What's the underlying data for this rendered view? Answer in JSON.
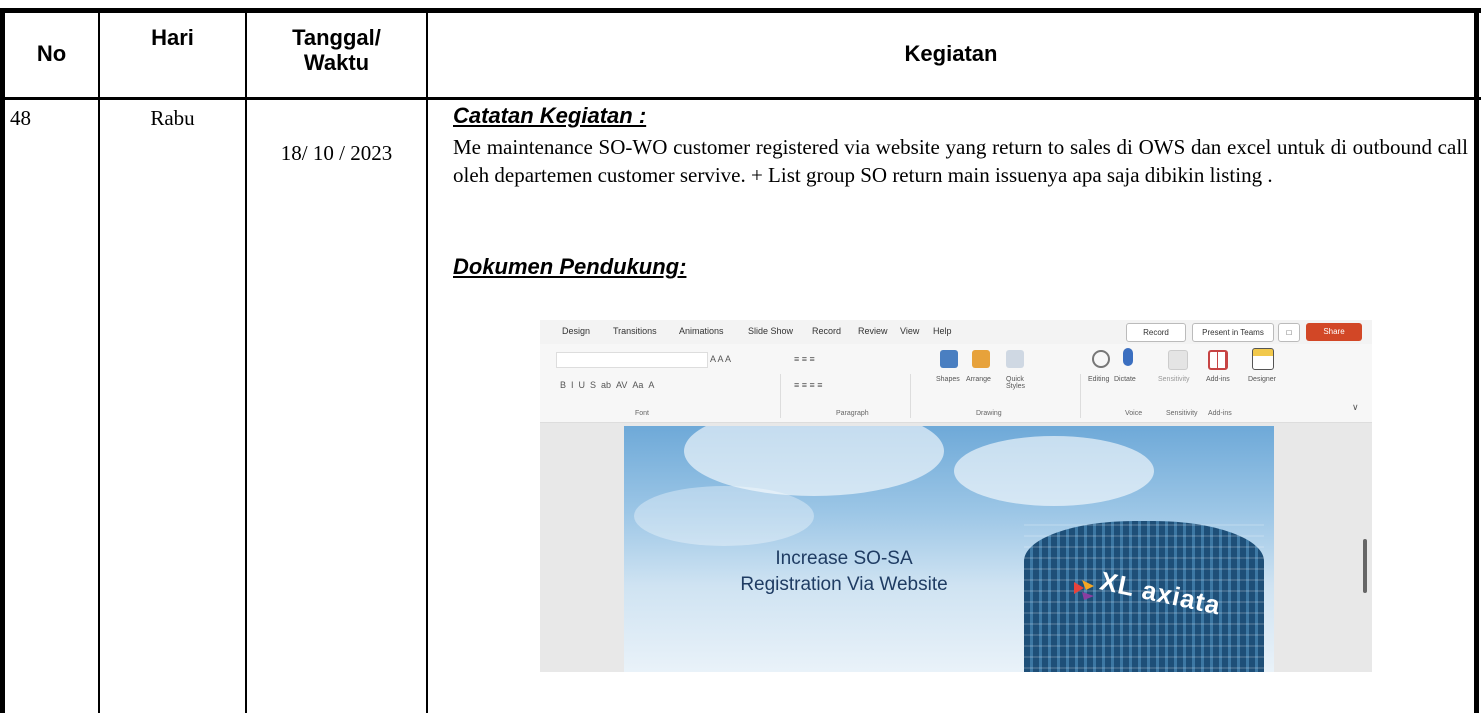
{
  "header": {
    "col_no": "No",
    "col_hari": "Hari",
    "col_tanggal_line1": "Tanggal/",
    "col_tanggal_line2": "Waktu",
    "col_kegiatan": "Kegiatan"
  },
  "row": {
    "no": "48",
    "hari": "Rabu",
    "tanggal": "18/ 10 / 2023",
    "catatan_title": "Catatan Kegiatan :",
    "catatan_text": "Me maintenance SO-WO customer registered via website yang return to sales di OWS dan excel untuk di outbound call oleh departemen customer servive. + List group SO return main issuenya apa saja dibikin listing .",
    "dokumen_title": "Dokumen Pendukung:"
  },
  "screenshot": {
    "menu": [
      "Design",
      "Transitions",
      "Animations",
      "Slide Show",
      "Record",
      "Review",
      "View",
      "Help"
    ],
    "record_btn": "Record",
    "present_btn": "Present in Teams",
    "share_btn": "Share",
    "groups": [
      "Font",
      "Paragraph",
      "Drawing",
      "Voice",
      "Sensitivity",
      "Add-ins"
    ],
    "tools": {
      "shapes": "Shapes",
      "arrange": "Arrange",
      "quick_styles": "Quick Styles",
      "editing": "Editing",
      "dictate": "Dictate",
      "sensitivity": "Sensitivity",
      "addins": "Add-ins",
      "designer": "Designer"
    },
    "slide_title_line1": "Increase SO-SA",
    "slide_title_line2": "Registration Via Website",
    "logo_text": "XL axiata"
  },
  "colors": {
    "share": "#d24726",
    "slide_title": "#1f3c63"
  }
}
